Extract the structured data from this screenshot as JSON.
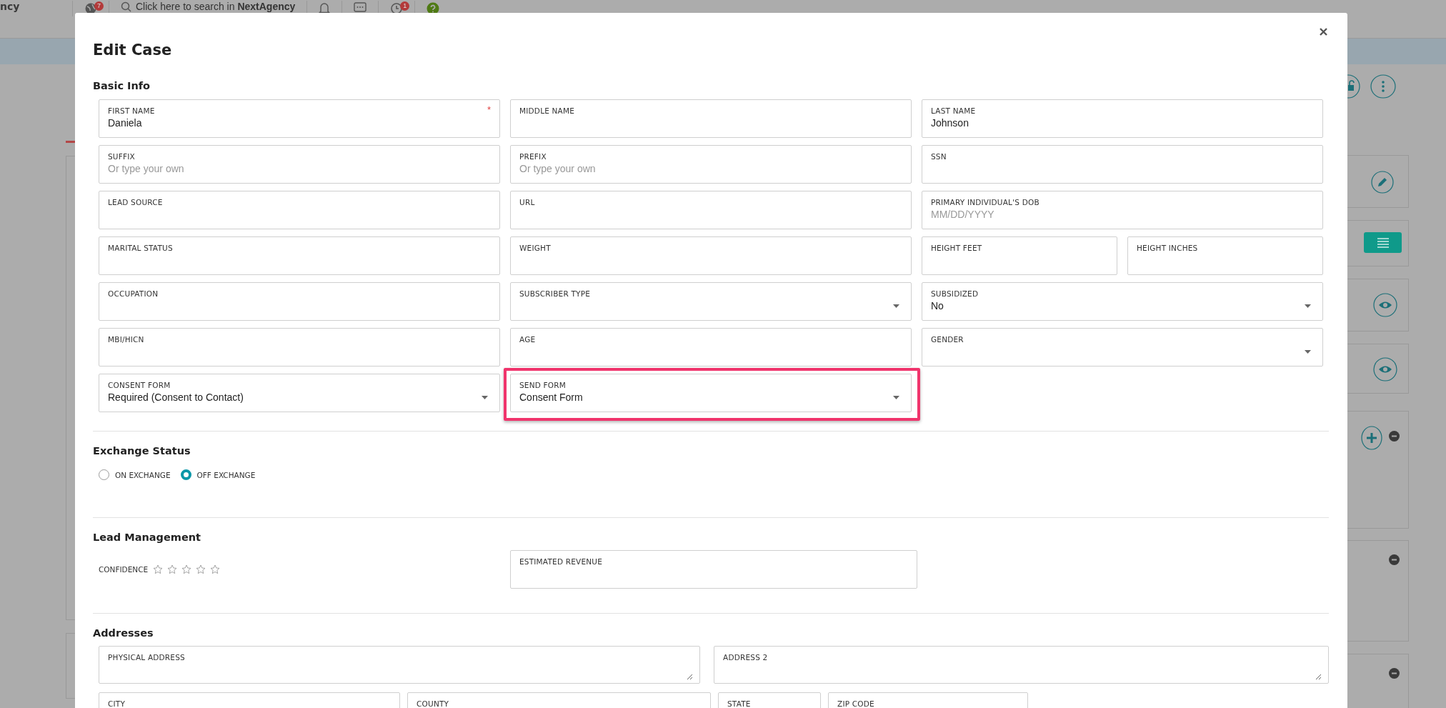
{
  "top_bar": {
    "brand": "ncy",
    "notifications_badge": "7",
    "search": "Click here to search in **NextAgency**",
    "alerts_badge": "1"
  },
  "modal": {
    "title": "Edit Case",
    "basic_info": {
      "heading": "Basic Info",
      "rows": [
        [
          {
            "label": "FIRST NAME",
            "value": "Daniela",
            "required_mark": "*",
            "kind": "text"
          },
          {
            "label": "MIDDLE NAME",
            "kind": "text"
          },
          {
            "label": "LAST NAME",
            "value": "Johnson",
            "kind": "text"
          }
        ],
        [
          {
            "label": "SUFFIX",
            "placeholder": "Or type your own",
            "kind": "text"
          },
          {
            "label": "PREFIX",
            "placeholder": "Or type your own",
            "kind": "text"
          },
          {
            "label": "SSN",
            "kind": "text"
          }
        ],
        [
          {
            "label": "LEAD SOURCE",
            "kind": "text"
          },
          {
            "label": "URL",
            "kind": "text"
          },
          {
            "label": "PRIMARY INDIVIDUAL'S DOB",
            "placeholder": "MM/DD/YYYY",
            "kind": "text"
          }
        ],
        [
          {
            "label": "MARITAL STATUS",
            "kind": "text"
          },
          {
            "label": "WEIGHT",
            "kind": "text"
          },
          {
            "label": "HEIGHT FEET",
            "kind": "text"
          },
          {
            "label": "HEIGHT INCHES",
            "kind": "text"
          }
        ],
        [
          {
            "label": "OCCUPATION",
            "kind": "text"
          },
          {
            "label": "SUBSCRIBER TYPE",
            "kind": "select"
          },
          {
            "label": "SUBSIDIZED",
            "value": "No",
            "kind": "select"
          }
        ],
        [
          {
            "label": "MBI/HICN",
            "kind": "text"
          },
          {
            "label": "AGE",
            "kind": "text"
          },
          {
            "label": "GENDER",
            "kind": "select"
          }
        ],
        [
          {
            "label": "CONSENT FORM",
            "value": "Required (Consent to Contact)",
            "kind": "select"
          },
          {
            "label": "SEND FORM",
            "value": "Consent Form",
            "kind": "select",
            "highlighted": true
          }
        ]
      ]
    },
    "exchange_status": {
      "heading": "Exchange Status",
      "options": [
        {
          "label": "ON EXCHANGE",
          "selected": false
        },
        {
          "label": "OFF EXCHANGE",
          "selected": true
        }
      ]
    },
    "lead_management": {
      "heading": "Lead Management",
      "confidence": {
        "label": "CONFIDENCE",
        "stars": 0
      },
      "revenue_field": {
        "label": "ESTIMATED REVENUE"
      }
    },
    "addresses": {
      "heading": "Addresses",
      "street_fields": [
        {
          "label": "PHYSICAL ADDRESS",
          "kind": "textarea"
        },
        {
          "label": "ADDRESS 2",
          "kind": "textarea"
        }
      ],
      "locality_fields": [
        {
          "label": "CITY"
        },
        {
          "label": "COUNTY"
        },
        {
          "label": "STATE"
        },
        {
          "label": "ZIP CODE"
        }
      ]
    }
  }
}
